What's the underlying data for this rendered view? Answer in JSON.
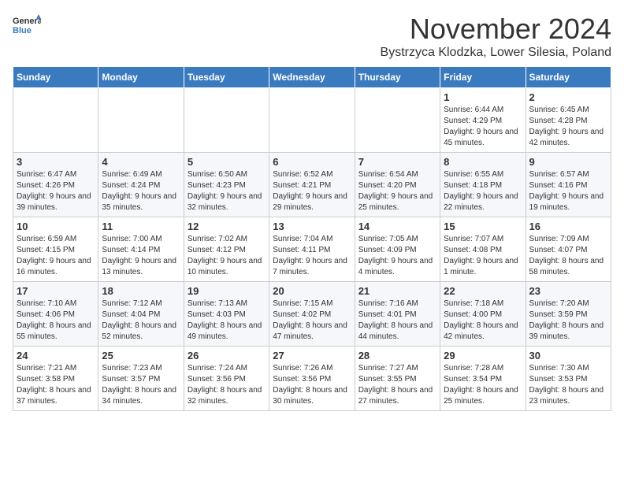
{
  "header": {
    "logo_general": "General",
    "logo_blue": "Blue",
    "month": "November 2024",
    "location": "Bystrzyca Klodzka, Lower Silesia, Poland"
  },
  "days_of_week": [
    "Sunday",
    "Monday",
    "Tuesday",
    "Wednesday",
    "Thursday",
    "Friday",
    "Saturday"
  ],
  "weeks": [
    [
      {
        "day": "",
        "info": ""
      },
      {
        "day": "",
        "info": ""
      },
      {
        "day": "",
        "info": ""
      },
      {
        "day": "",
        "info": ""
      },
      {
        "day": "",
        "info": ""
      },
      {
        "day": "1",
        "info": "Sunrise: 6:44 AM\nSunset: 4:29 PM\nDaylight: 9 hours and 45 minutes."
      },
      {
        "day": "2",
        "info": "Sunrise: 6:45 AM\nSunset: 4:28 PM\nDaylight: 9 hours and 42 minutes."
      }
    ],
    [
      {
        "day": "3",
        "info": "Sunrise: 6:47 AM\nSunset: 4:26 PM\nDaylight: 9 hours and 39 minutes."
      },
      {
        "day": "4",
        "info": "Sunrise: 6:49 AM\nSunset: 4:24 PM\nDaylight: 9 hours and 35 minutes."
      },
      {
        "day": "5",
        "info": "Sunrise: 6:50 AM\nSunset: 4:23 PM\nDaylight: 9 hours and 32 minutes."
      },
      {
        "day": "6",
        "info": "Sunrise: 6:52 AM\nSunset: 4:21 PM\nDaylight: 9 hours and 29 minutes."
      },
      {
        "day": "7",
        "info": "Sunrise: 6:54 AM\nSunset: 4:20 PM\nDaylight: 9 hours and 25 minutes."
      },
      {
        "day": "8",
        "info": "Sunrise: 6:55 AM\nSunset: 4:18 PM\nDaylight: 9 hours and 22 minutes."
      },
      {
        "day": "9",
        "info": "Sunrise: 6:57 AM\nSunset: 4:16 PM\nDaylight: 9 hours and 19 minutes."
      }
    ],
    [
      {
        "day": "10",
        "info": "Sunrise: 6:59 AM\nSunset: 4:15 PM\nDaylight: 9 hours and 16 minutes."
      },
      {
        "day": "11",
        "info": "Sunrise: 7:00 AM\nSunset: 4:14 PM\nDaylight: 9 hours and 13 minutes."
      },
      {
        "day": "12",
        "info": "Sunrise: 7:02 AM\nSunset: 4:12 PM\nDaylight: 9 hours and 10 minutes."
      },
      {
        "day": "13",
        "info": "Sunrise: 7:04 AM\nSunset: 4:11 PM\nDaylight: 9 hours and 7 minutes."
      },
      {
        "day": "14",
        "info": "Sunrise: 7:05 AM\nSunset: 4:09 PM\nDaylight: 9 hours and 4 minutes."
      },
      {
        "day": "15",
        "info": "Sunrise: 7:07 AM\nSunset: 4:08 PM\nDaylight: 9 hours and 1 minute."
      },
      {
        "day": "16",
        "info": "Sunrise: 7:09 AM\nSunset: 4:07 PM\nDaylight: 8 hours and 58 minutes."
      }
    ],
    [
      {
        "day": "17",
        "info": "Sunrise: 7:10 AM\nSunset: 4:06 PM\nDaylight: 8 hours and 55 minutes."
      },
      {
        "day": "18",
        "info": "Sunrise: 7:12 AM\nSunset: 4:04 PM\nDaylight: 8 hours and 52 minutes."
      },
      {
        "day": "19",
        "info": "Sunrise: 7:13 AM\nSunset: 4:03 PM\nDaylight: 8 hours and 49 minutes."
      },
      {
        "day": "20",
        "info": "Sunrise: 7:15 AM\nSunset: 4:02 PM\nDaylight: 8 hours and 47 minutes."
      },
      {
        "day": "21",
        "info": "Sunrise: 7:16 AM\nSunset: 4:01 PM\nDaylight: 8 hours and 44 minutes."
      },
      {
        "day": "22",
        "info": "Sunrise: 7:18 AM\nSunset: 4:00 PM\nDaylight: 8 hours and 42 minutes."
      },
      {
        "day": "23",
        "info": "Sunrise: 7:20 AM\nSunset: 3:59 PM\nDaylight: 8 hours and 39 minutes."
      }
    ],
    [
      {
        "day": "24",
        "info": "Sunrise: 7:21 AM\nSunset: 3:58 PM\nDaylight: 8 hours and 37 minutes."
      },
      {
        "day": "25",
        "info": "Sunrise: 7:23 AM\nSunset: 3:57 PM\nDaylight: 8 hours and 34 minutes."
      },
      {
        "day": "26",
        "info": "Sunrise: 7:24 AM\nSunset: 3:56 PM\nDaylight: 8 hours and 32 minutes."
      },
      {
        "day": "27",
        "info": "Sunrise: 7:26 AM\nSunset: 3:56 PM\nDaylight: 8 hours and 30 minutes."
      },
      {
        "day": "28",
        "info": "Sunrise: 7:27 AM\nSunset: 3:55 PM\nDaylight: 8 hours and 27 minutes."
      },
      {
        "day": "29",
        "info": "Sunrise: 7:28 AM\nSunset: 3:54 PM\nDaylight: 8 hours and 25 minutes."
      },
      {
        "day": "30",
        "info": "Sunrise: 7:30 AM\nSunset: 3:53 PM\nDaylight: 8 hours and 23 minutes."
      }
    ]
  ]
}
